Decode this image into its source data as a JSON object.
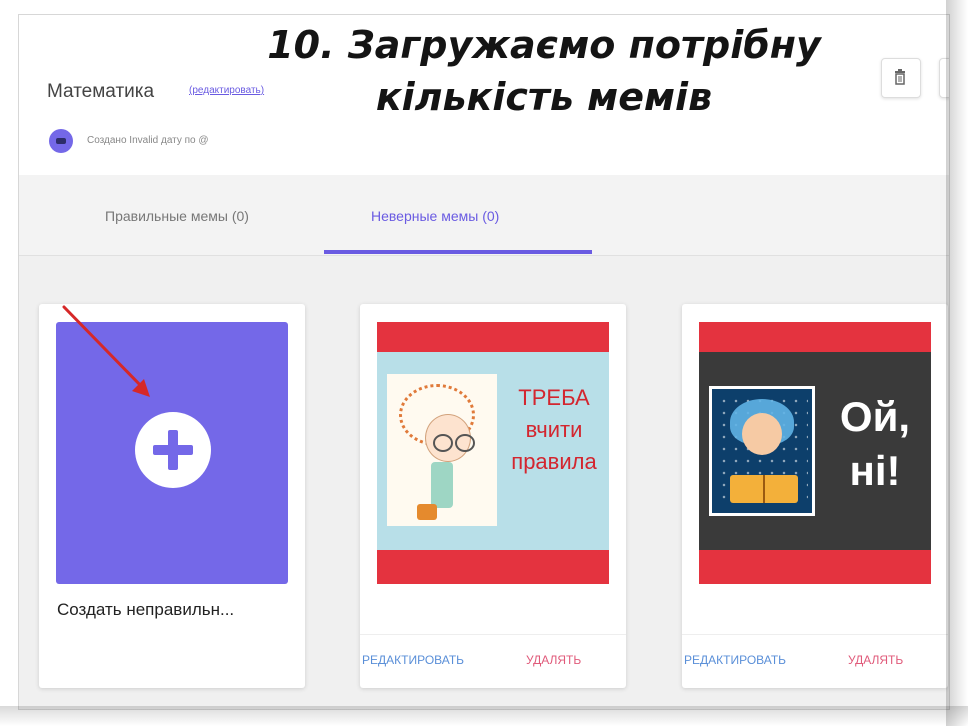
{
  "overlay": {
    "line1": "10. Загружаємо потрібну",
    "line2": "кількість мемів"
  },
  "header": {
    "title": "Математика",
    "edit_link": "(редактировать)",
    "creator_text": "Создано Invalid дату по @"
  },
  "tabs": {
    "correct": "Правильные мемы (0)",
    "incorrect": "Неверные мемы (0)",
    "active": "incorrect"
  },
  "cards": {
    "create_label": "Создать неправильн...",
    "meme1_text": [
      "ТРЕБА",
      "вчити",
      "правила"
    ],
    "meme2_text": [
      "Ой,",
      "ні!"
    ],
    "edit_label": "РЕДАКТИРОВАТЬ",
    "delete_label": "УДАЛЯТЬ"
  },
  "colors": {
    "accent": "#6a5be2",
    "tile": "#7468e8",
    "meme_frame": "#e4333f",
    "annotation_arrow": "#d62828"
  },
  "icons": [
    "trash-icon",
    "plus-icon",
    "arrow-icon"
  ]
}
